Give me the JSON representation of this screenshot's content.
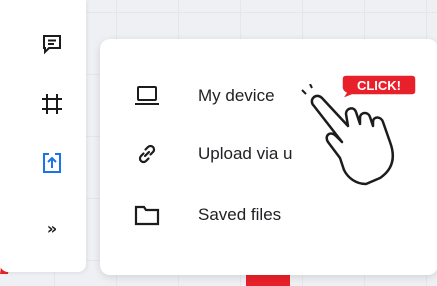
{
  "toolbar": {
    "tools": [
      {
        "icon": "comment-icon"
      },
      {
        "icon": "crop-icon"
      },
      {
        "icon": "upload-icon",
        "active": true
      },
      {
        "icon": "more-icon",
        "label": "»"
      }
    ]
  },
  "upload_menu": {
    "items": [
      {
        "icon": "laptop-icon",
        "label": "My device"
      },
      {
        "icon": "link-icon",
        "label": "Upload via u"
      },
      {
        "icon": "folder-icon",
        "label": "Saved files"
      }
    ]
  },
  "overlay": {
    "badge_text": "CLICK!"
  },
  "colors": {
    "accent": "#1a73e8",
    "badge": "#e8202a",
    "text": "#202124"
  }
}
